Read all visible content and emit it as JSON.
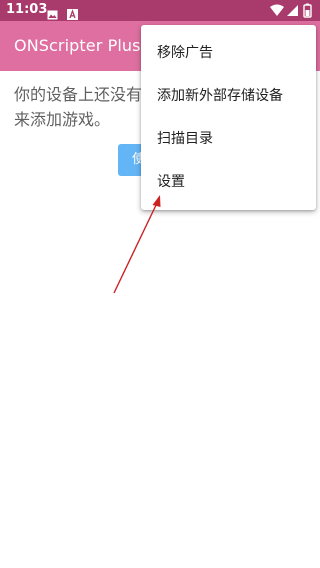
{
  "status_bar": {
    "time": "11:03",
    "left_icons": [
      "image-icon",
      "text-a-icon"
    ],
    "right_icons": [
      "wifi-icon",
      "signal-icon",
      "battery-icon"
    ],
    "background": "#a93a6c"
  },
  "toolbar": {
    "title": "ONScripter Plus",
    "background": "#de6fa0"
  },
  "main": {
    "empty_message": "你的设备上还没有\n来添加游戏。",
    "button_label": "使"
  },
  "overflow_menu": {
    "items": [
      {
        "label": "移除广告"
      },
      {
        "label": "添加新外部存储设备"
      },
      {
        "label": "扫描目录"
      },
      {
        "label": "设置"
      }
    ]
  },
  "annotation": {
    "arrow_color": "#cc2222"
  }
}
